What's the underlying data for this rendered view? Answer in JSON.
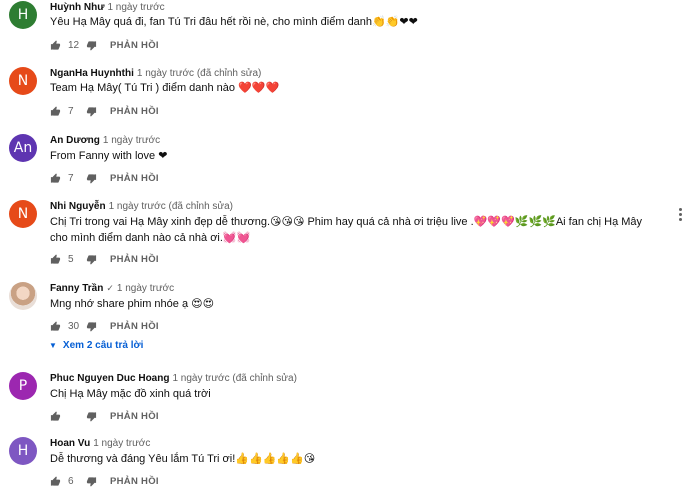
{
  "reply_label": "PHẢN HỒI",
  "comments": [
    {
      "avatar_letter": "H",
      "avatar_color": "#2e7d32",
      "author": "Huỳnh Như",
      "meta": "1 ngày trước",
      "text": "Yêu Hạ Mây quá đi, fan Tú Tri đâu hết rồi nè, cho mình điểm danh👏👏❤❤",
      "likes": "12"
    },
    {
      "avatar_letter": "N",
      "avatar_color": "#e64a19",
      "author": "NganHa Huynhthi",
      "meta": "1 ngày trước (đã chỉnh sửa)",
      "text": "Team Hạ Mây( Tú Tri ) điểm danh nào ❤️❤️❤️",
      "likes": "7"
    },
    {
      "avatar_letter": "An",
      "avatar_color": "#5e35b1",
      "author": "An Dương",
      "meta": "1 ngày trước",
      "text": "From Fanny  with love ❤",
      "likes": "7"
    },
    {
      "avatar_letter": "N",
      "avatar_color": "#e64a19",
      "author": "Nhi Nguyễn",
      "meta": "1 ngày trước (đã chỉnh sửa)",
      "text": "Chị Tri trong vai Hạ Mây xinh đẹp dễ thương.😘😘😘 Phim hay quá cả nhà ơi triệu live .💖💖💖🌿🌿🌿Ai fan chị Hạ Mây cho mình điểm danh nào cả nhà ơi.💓💓",
      "likes": "5"
    },
    {
      "avatar_photo": true,
      "author": "Fanny Trần",
      "verified": "✓",
      "meta": "1 ngày trước",
      "text": "Mng nhớ share phim nhóe ạ 😍😍",
      "likes": "30",
      "replies_label": "Xem 2 câu trả lời"
    },
    {
      "avatar_letter": "P",
      "avatar_color": "#9c27b0",
      "author": "Phuc Nguyen Duc Hoang",
      "meta": "1 ngày trước (đã chỉnh sửa)",
      "text": "Chị Hạ Mây mặc đồ xinh quá trời",
      "likes": ""
    },
    {
      "avatar_letter": "H",
      "avatar_color": "#7e57c2",
      "author": "Hoan Vu",
      "meta": "1 ngày trước",
      "text": "Dễ thương và đáng Yêu lắm Tú Tri ơi!👍👍👍👍👍😘",
      "likes": "6"
    }
  ]
}
